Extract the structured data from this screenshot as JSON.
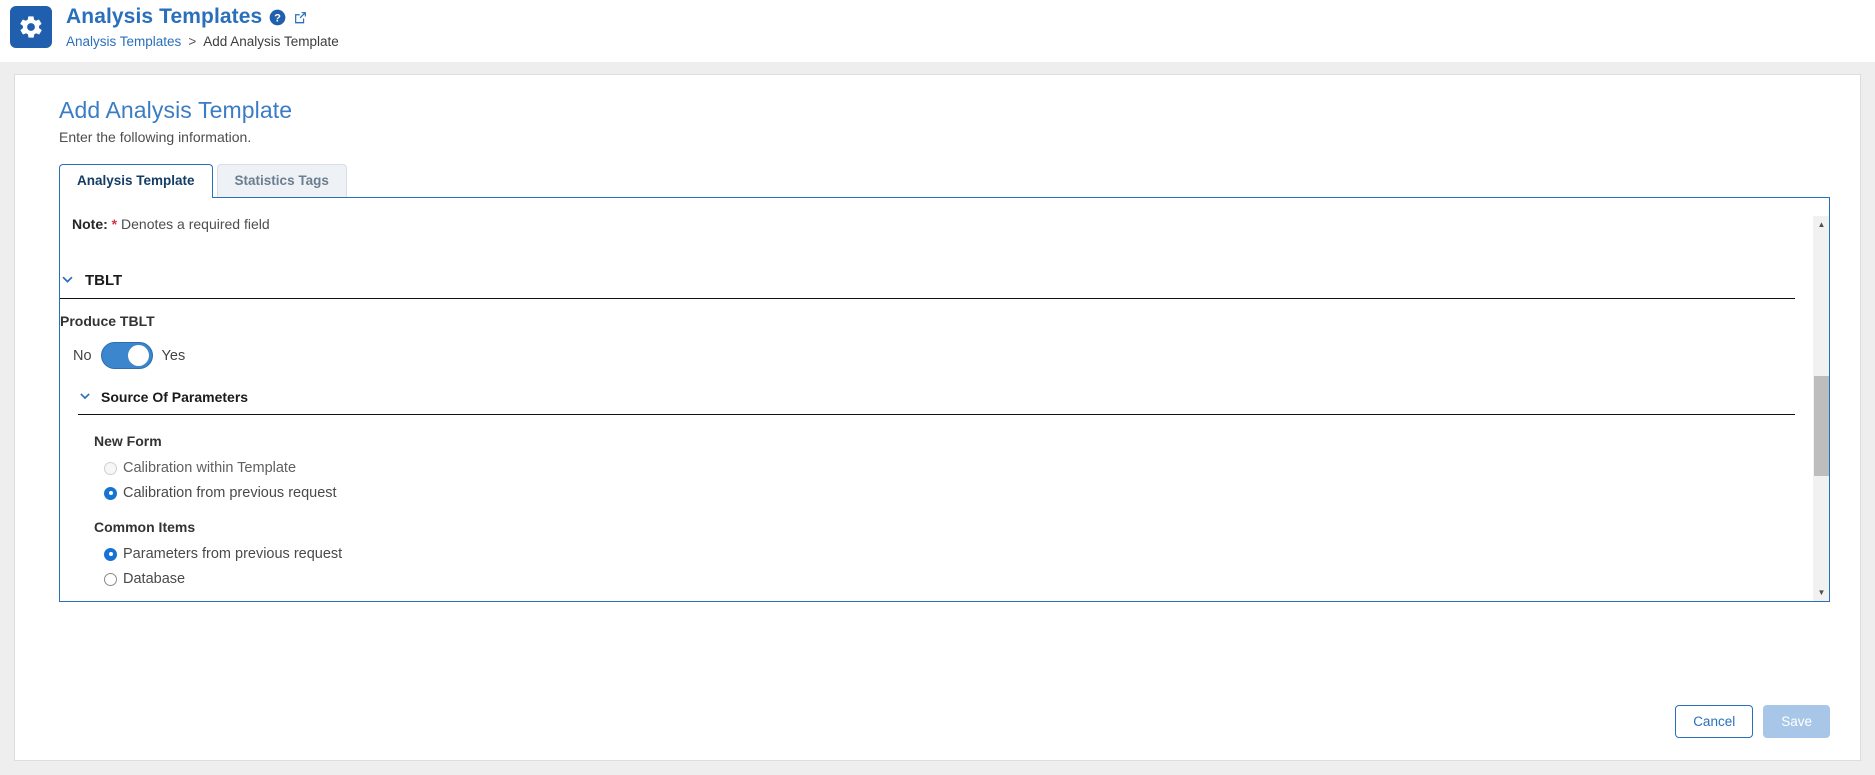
{
  "header": {
    "gear_icon": "gear-icon",
    "title": "Analysis Templates",
    "help_icon": "help-circle-icon",
    "external_link_icon": "external-link-icon",
    "breadcrumb": {
      "root": "Analysis Templates",
      "separator": ">",
      "current": "Add Analysis Template"
    }
  },
  "page": {
    "title": "Add Analysis Template",
    "subtitle": "Enter the following information."
  },
  "tabs": [
    {
      "label": "Analysis Template",
      "active": true
    },
    {
      "label": "Statistics Tags",
      "active": false
    }
  ],
  "note": {
    "prefix": "Note:",
    "star": "*",
    "text": "Denotes a required field"
  },
  "sections": {
    "tblt": {
      "chevron_icon": "chevron-down-icon",
      "title": "TBLT",
      "produce_label": "Produce TBLT",
      "toggle": {
        "off_label": "No",
        "on_label": "Yes",
        "value": "Yes",
        "checked": true
      },
      "source_of_parameters": {
        "chevron_icon": "chevron-down-icon",
        "title": "Source Of Parameters",
        "new_form": {
          "label": "New Form",
          "options": [
            {
              "label": "Calibration within Template",
              "checked": false,
              "disabled": true
            },
            {
              "label": "Calibration from previous request",
              "checked": true,
              "disabled": false
            }
          ]
        },
        "common_items": {
          "label": "Common Items",
          "options": [
            {
              "label": "Parameters from previous request",
              "checked": true,
              "disabled": false
            },
            {
              "label": "Database",
              "checked": false,
              "disabled": false
            }
          ]
        }
      }
    }
  },
  "scrollbar": {
    "up_arrow": "▲",
    "down_arrow": "▼"
  },
  "footer": {
    "cancel_label": "Cancel",
    "save_label": "Save"
  },
  "colors": {
    "accent": "#2a6fbb",
    "brand_badge": "#1f5fad",
    "required_star": "#d6344a",
    "toggle_on": "#3b86cd",
    "radio_checked": "#1673d4",
    "save_disabled": "#a8c7e8"
  }
}
